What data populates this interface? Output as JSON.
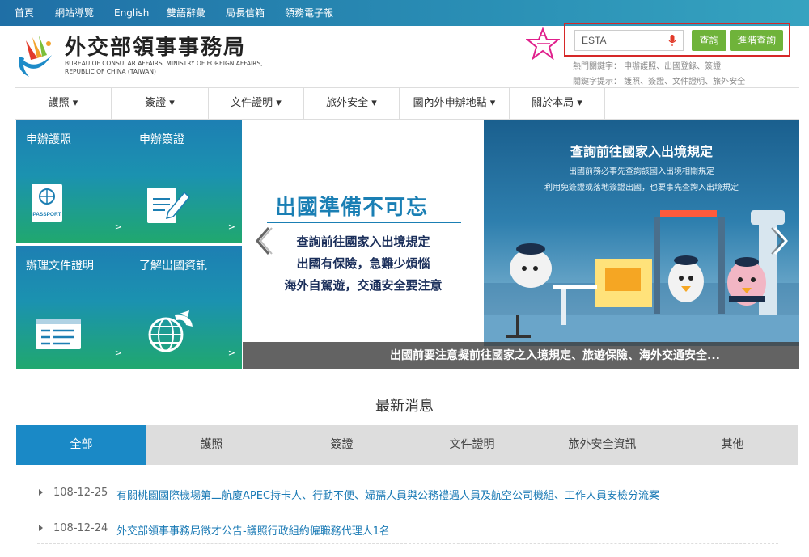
{
  "topnav": [
    "首頁",
    "網站導覽",
    "English",
    "雙語辭彙",
    "局長信箱",
    "領務電子報"
  ],
  "logo": {
    "title": "外交部領事事務局",
    "subtitle": "BUREAU OF CONSULAR AFFAIRS, MINISTRY OF FOREIGN AFFAIRS, REPUBLIC OF CHINA (TAIWAN)"
  },
  "search": {
    "value": "ESTA",
    "search_label": "查詢",
    "advanced_label": "進階查詢",
    "hot_keywords": "熱門關鍵字：  申辦護照、出國登錄、簽證",
    "keyword_hint": "關鍵字提示：  護照、簽證、文件證明、旅外安全"
  },
  "mainnav": [
    "護照 ▾",
    "簽證 ▾",
    "文件證明 ▾",
    "旅外安全 ▾",
    "國內外申辦地點 ▾",
    "關於本局 ▾"
  ],
  "tiles": [
    {
      "label": "申辦護照",
      "arrow": ">",
      "icon": "passport-icon",
      "badge": "PASSPORT"
    },
    {
      "label": "申辦簽證",
      "arrow": ">",
      "icon": "document-pen-icon"
    },
    {
      "label": "辦理文件證明",
      "arrow": ">",
      "icon": "document-window-icon"
    },
    {
      "label": "了解出國資訊",
      "arrow": ">",
      "icon": "globe-plane-icon"
    }
  ],
  "banner": {
    "headline": "出國準備不可忘",
    "lines": [
      "查詢前往國家入出境規定",
      "出國有保險，急難少煩惱",
      "海外自駕遊，交通安全要注意"
    ],
    "right_title": "查詢前往國家入出境規定",
    "right_sub": [
      "出國前務必事先查詢該國入出境相關規定",
      "利用免簽證或落地簽證出國，也要事先查詢入出境規定"
    ],
    "caption": "出國前要注意擬前往國家之入境規定、旅遊保險、海外交通安全..."
  },
  "news": {
    "title": "最新消息",
    "tabs": [
      "全部",
      "護照",
      "簽證",
      "文件證明",
      "旅外安全資訊",
      "其他"
    ],
    "items": [
      {
        "date": "108-12-25",
        "text": "有關桃園國際機場第二航廈APEC持卡人、行動不便、婦孺人員與公務禮遇人員及航空公司機組、工作人員安檢分流案"
      },
      {
        "date": "108-12-24",
        "text": "外交部領事事務局徵才公告-護照行政組約僱職務代理人1名"
      }
    ]
  },
  "colors": {
    "topbar": "#1f6fa6",
    "accent": "#1a89c6",
    "green_button": "#6fb33a",
    "highlight_border": "#d62828"
  }
}
